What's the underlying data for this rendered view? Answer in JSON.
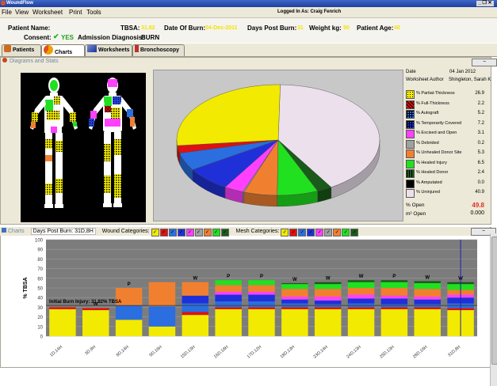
{
  "window": {
    "title": "WoundFlow",
    "controls": "_ ❐ ✕"
  },
  "menu": {
    "items": [
      "File",
      "View",
      "Worksheet",
      "Print",
      "Tools"
    ],
    "logged_in": "Logged In As: Craig Fenrich"
  },
  "patient": {
    "name_label": "Patient Name:",
    "tbsa_label": "TBSA:",
    "tbsa_value": "31.82",
    "dob_label": "Date Of Burn:",
    "dob_value": "04-Dec-2011",
    "dpb_label": "Days Post Burn:",
    "dpb_value": "31",
    "weight_label": "Weight kg:",
    "weight_value": "90",
    "age_label": "Patient Age:",
    "age_value": "40",
    "consent_label": "Consent:",
    "consent_value": "YES",
    "diagnosis_label": "Admission Diagnosis:",
    "diagnosis_value": "BURN"
  },
  "tabs": [
    "Patients",
    "Charts",
    "Worksheets",
    "Bronchoscopy"
  ],
  "diagrams_section": {
    "title": "Diagrams and Stats",
    "collapse": "−"
  },
  "stats": {
    "date_label": "Date",
    "date_value": "04 Jan 2012",
    "author_label": "Worksheet Author",
    "author_value": "Shingleton, Sarah K",
    "items": [
      {
        "label": "% Partial-Thickness",
        "value": "26.9",
        "color": "#f2ea00",
        "pattern": "dots"
      },
      {
        "label": "% Full-Thickness",
        "value": "2.2",
        "color": "#e01010",
        "pattern": "cross"
      },
      {
        "label": "% Autograft",
        "value": "5.2",
        "color": "#2a6ee0",
        "pattern": "grid"
      },
      {
        "label": "% Temporarily Covered",
        "value": "7.2",
        "color": "#2030d8",
        "pattern": "grid"
      },
      {
        "label": "% Excised and Open",
        "value": "3.1",
        "color": "#ff40ff",
        "pattern": "solid"
      },
      {
        "label": "% Debrided",
        "value": "0.2",
        "color": "#a0a0a0",
        "pattern": "solid"
      },
      {
        "label": "% Unhealed Donor Site",
        "value": "5.3",
        "color": "#f08030",
        "pattern": "solid"
      },
      {
        "label": "% Healed Injury",
        "value": "6.5",
        "color": "#20e020",
        "pattern": "solid"
      },
      {
        "label": "% Healed Donor",
        "value": "2.4",
        "color": "#1a5a1a",
        "pattern": "stripes"
      },
      {
        "label": "% Amputated",
        "value": "0.0",
        "color": "#000000",
        "pattern": "solid"
      },
      {
        "label": "% Uninjured",
        "value": "40.9",
        "color": "#ece0ec",
        "pattern": "solid"
      }
    ],
    "open_label": "% Open",
    "open_value": "49.8",
    "m2_label": "m² Open",
    "m2_value": "0.000"
  },
  "charts_section": {
    "title": "Charts",
    "dpb_text": "Days Post Burn: 31D,8H",
    "wound_label": "Wound Categories:",
    "mesh_label": "Mesh Categories:",
    "collapse": "−"
  },
  "chart_data": {
    "type": "bar",
    "ylabel": "% TBSA",
    "ylim": [
      0,
      100
    ],
    "yticks": [
      0,
      10,
      20,
      30,
      40,
      50,
      60,
      70,
      80,
      90,
      100
    ],
    "annotation": "Initial Burn Injury: 31.82% TBSA",
    "reference_line": 31.82,
    "categories": [
      "1D,14H",
      "3D,8H",
      "9D,14H",
      "9D,16H",
      "15D,13H",
      "16D,18H",
      "17D,12H",
      "18D,13H",
      "23D,14H",
      "24D,13H",
      "25D,13H",
      "28D,16H",
      "31D,8H"
    ],
    "bar_markers": [
      "",
      "W",
      "P",
      "",
      "W",
      "P",
      "P",
      "W",
      "W",
      "W",
      "P",
      "W",
      "W"
    ],
    "series": [
      {
        "name": "% Partial-Thickness",
        "color": "#f2ea00",
        "values": [
          28,
          27,
          17,
          10,
          22,
          28,
          28,
          28,
          28,
          28,
          28,
          28,
          27
        ]
      },
      {
        "name": "% Full-Thickness",
        "color": "#e01010",
        "values": [
          2,
          2,
          0,
          0,
          3,
          2,
          2,
          2,
          2,
          2,
          2,
          2,
          2
        ]
      },
      {
        "name": "% Autograft",
        "color": "#2a6ee0",
        "values": [
          0,
          0,
          15,
          21,
          9,
          6,
          6,
          4,
          3,
          4,
          3,
          3,
          5
        ]
      },
      {
        "name": "% Temporarily Covered",
        "color": "#2030d8",
        "values": [
          0,
          0,
          0,
          0,
          8,
          7,
          7,
          4,
          4,
          5,
          6,
          5,
          6
        ]
      },
      {
        "name": "% Excised and Open",
        "color": "#ff40ff",
        "values": [
          0,
          0,
          0,
          0,
          0,
          3,
          3,
          3,
          4,
          4,
          3,
          3,
          3
        ]
      },
      {
        "name": "% Unhealed Donor Site",
        "color": "#f08030",
        "values": [
          0,
          0,
          18,
          25,
          14,
          7,
          7,
          8,
          8,
          7,
          8,
          8,
          5
        ]
      },
      {
        "name": "% Healed Injury",
        "color": "#20e020",
        "values": [
          0,
          0,
          0,
          0,
          0,
          5,
          5,
          5,
          5,
          6,
          6,
          6,
          6
        ]
      },
      {
        "name": "% Healed Donor",
        "color": "#1a5a1a",
        "values": [
          0,
          0,
          0,
          0,
          0,
          0,
          0,
          1,
          2,
          2,
          2,
          2,
          2
        ]
      }
    ]
  }
}
